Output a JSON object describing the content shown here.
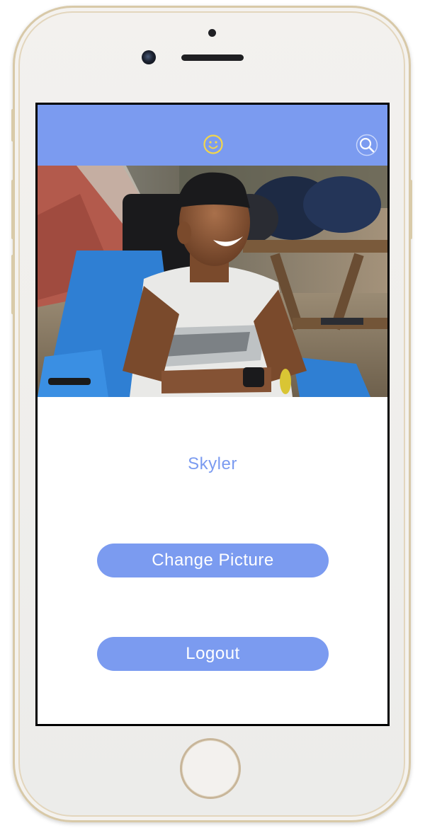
{
  "navbar": {
    "center_icon": "smiley-face-icon",
    "right_icon": "search-icon",
    "background_color": "#7b9bf0",
    "center_icon_color": "#f2d64b"
  },
  "profile": {
    "photo_icon": "profile-photo",
    "name": "Skyler"
  },
  "actions": {
    "change_picture_label": "Change Picture",
    "logout_label": "Logout"
  },
  "colors": {
    "accent": "#7b9bf0",
    "button_text": "#ffffff"
  }
}
